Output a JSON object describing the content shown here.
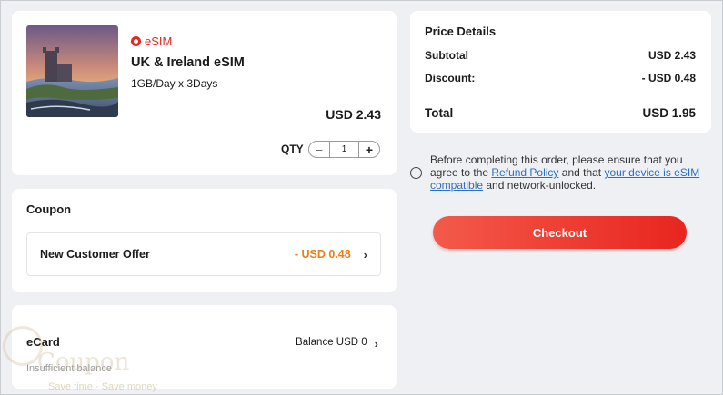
{
  "product": {
    "image_icon": "landscape-castle-photo",
    "brand": "eSIM",
    "name": "UK & Ireland eSIM",
    "plan": "1GB/Day x 3Days",
    "price": "USD 2.43",
    "qty_label": "QTY",
    "qty_minus": "−",
    "qty_value": "1",
    "qty_plus": "+"
  },
  "coupon": {
    "title": "Coupon",
    "offer_name": "New Customer Offer",
    "offer_amount": "- USD 0.48",
    "chevron": "›"
  },
  "ecard": {
    "title": "eCard",
    "balance": "Balance USD 0",
    "chevron": "›",
    "note": "Insufficient balance"
  },
  "price_details": {
    "title": "Price Details",
    "subtotal_label": "Subtotal",
    "subtotal_value": "USD 2.43",
    "discount_label": "Discount:",
    "discount_value": "- USD 0.48",
    "total_label": "Total",
    "total_value": "USD 1.95"
  },
  "agreement": {
    "text_1": "Before completing this order, please ensure that you agree to the ",
    "link_1": "Refund Policy",
    "text_2": " and that ",
    "link_2": "your device is eSIM compatible",
    "text_3": " and network-unlocked."
  },
  "checkout_label": "Checkout",
  "watermark": {
    "text": "Coupon",
    "tagline": "Save time · Save money"
  },
  "colors": {
    "accent": "#e8261f",
    "discount": "#ef7d16",
    "link": "#2b6ec8"
  }
}
